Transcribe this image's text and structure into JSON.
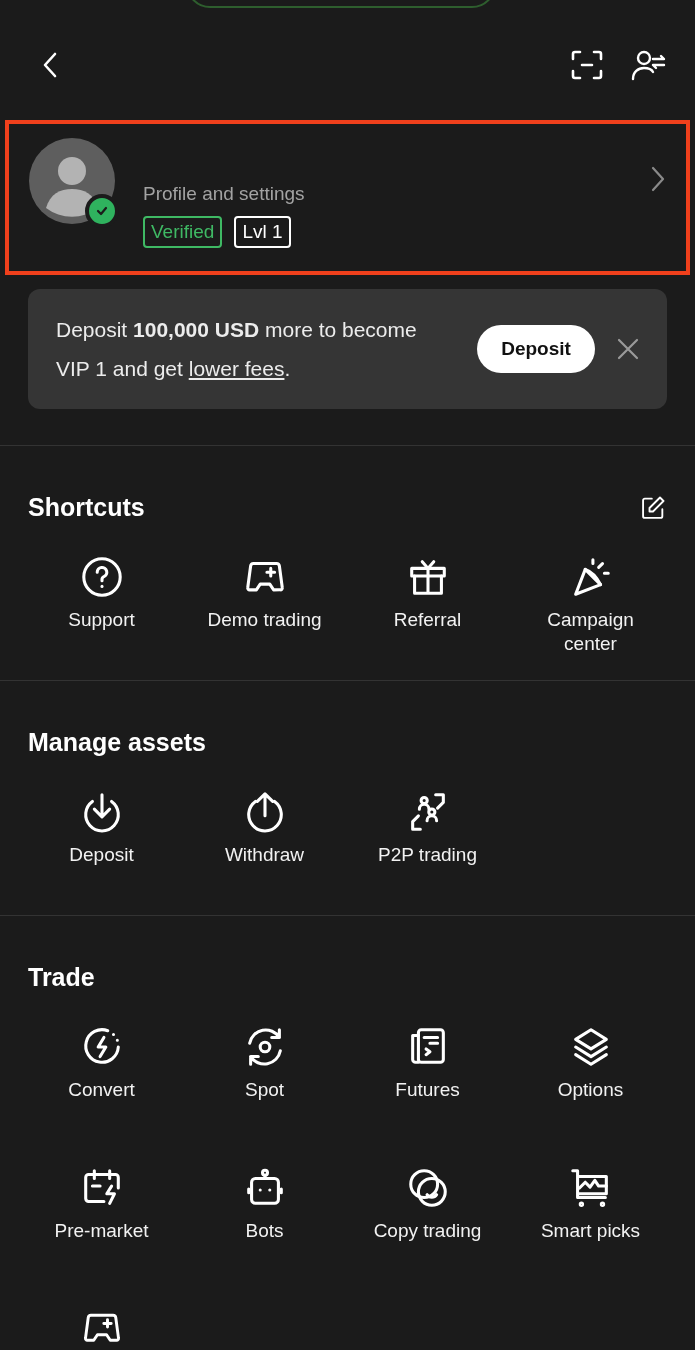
{
  "profile": {
    "highlighted": true,
    "verified": true,
    "title": "Profile and settings",
    "badges": [
      {
        "label": "Verified",
        "color": "#3fb964"
      },
      {
        "label": "Lvl 1",
        "color": "#ffffff"
      }
    ]
  },
  "promo": {
    "text": "Deposit **100,000 USD** more to become VIP 1 and get ",
    "link": "lower fees",
    "after_link": ".",
    "button": "Deposit"
  },
  "sections": [
    {
      "title": "Shortcuts",
      "editable": true,
      "items": [
        {
          "kind": "tile",
          "label": "Support"
        },
        {
          "kind": "tile",
          "label": "Demo trading"
        },
        {
          "kind": "tile",
          "label": "Referral"
        },
        {
          "kind": "tile",
          "label": "Campaign center"
        }
      ]
    },
    {
      "title": "Manage assets",
      "editable": false,
      "items": [
        {
          "kind": "tile",
          "label": "Deposit"
        },
        {
          "kind": "tile",
          "label": "Withdraw"
        },
        {
          "kind": "tile",
          "label": "P2P trading"
        }
      ]
    },
    {
      "title": "Trade",
      "editable": false,
      "items": [
        {
          "kind": "tile",
          "label": "Convert"
        },
        {
          "kind": "tile",
          "label": "Spot"
        },
        {
          "kind": "tile",
          "label": "Futures"
        },
        {
          "kind": "tile",
          "label": "Options"
        },
        {
          "kind": "tile",
          "label": "Pre-market"
        },
        {
          "kind": "tile",
          "label": "Bots"
        },
        {
          "kind": "tile",
          "label": "Copy trading"
        },
        {
          "kind": "tile",
          "label": "Smart picks"
        },
        {
          "kind": "cut_off"
        }
      ]
    }
  ]
}
